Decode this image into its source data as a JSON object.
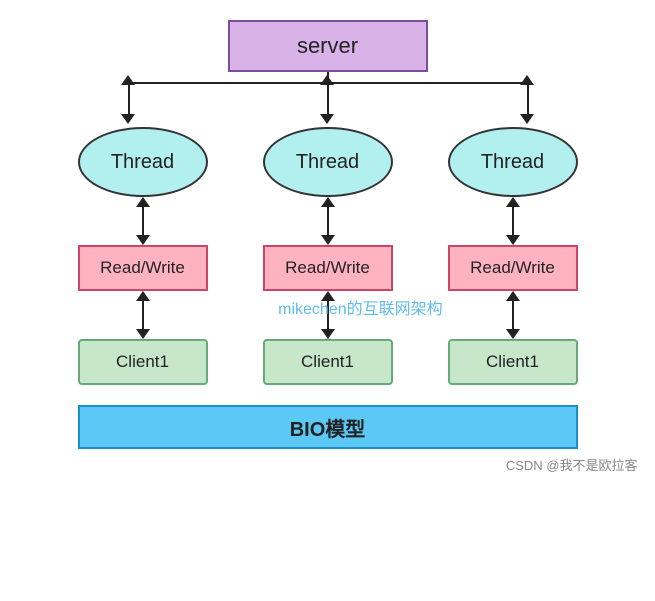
{
  "diagram": {
    "server": {
      "label": "server"
    },
    "threads": [
      {
        "label": "Thread"
      },
      {
        "label": "Thread"
      },
      {
        "label": "Thread"
      }
    ],
    "readwrite": [
      {
        "label": "Read/Write"
      },
      {
        "label": "Read/Write"
      },
      {
        "label": "Read/Write"
      }
    ],
    "clients": [
      {
        "label": "Client1"
      },
      {
        "label": "Client1"
      },
      {
        "label": "Client1"
      }
    ],
    "watermark": "mikechen的互联网架构",
    "bio_label": "BIO模型",
    "footer": "CSDN @我不是欧拉客"
  }
}
